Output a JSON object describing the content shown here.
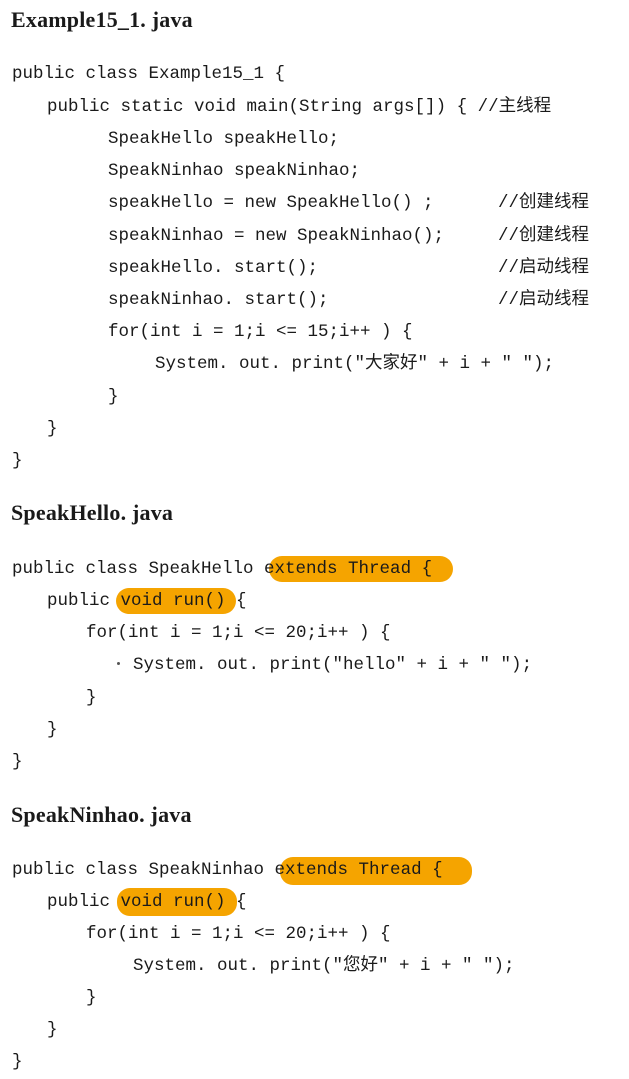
{
  "files": [
    {
      "title": "Example15_1. java",
      "lines": [
        "public class Example15_1 {",
        "public static void main(String args[]) { //主线程",
        "SpeakHello speakHello;",
        "SpeakNinhao speakNinhao;",
        "speakHello = new SpeakHello() ;",
        "//创建线程",
        "speakNinhao = new SpeakNinhao();",
        "//创建线程",
        "speakHello. start();",
        "//启动线程",
        "speakNinhao. start();",
        "//启动线程",
        "for(int i = 1;i <= 15;i++ ) {",
        "System. out. print(\"大家好\" + i + \" \");",
        "}",
        "}",
        "}"
      ]
    },
    {
      "title": "SpeakHello. java",
      "lines": [
        "public class SpeakHello extends Thread {",
        "public void run() {",
        "for(int i = 1;i <= 20;i++ ) {",
        "System. out. print(\"hello\" + i + \" \");",
        "}",
        "}",
        "}"
      ]
    },
    {
      "title": "SpeakNinhao. java",
      "lines": [
        "public class SpeakNinhao extends Thread {",
        "public void run() {",
        "for(int i = 1;i <= 20;i++ ) {",
        "System. out. print(\"您好\" + i + \" \");",
        "}",
        "}",
        "}"
      ]
    }
  ],
  "highlight_color": "#f5a400"
}
